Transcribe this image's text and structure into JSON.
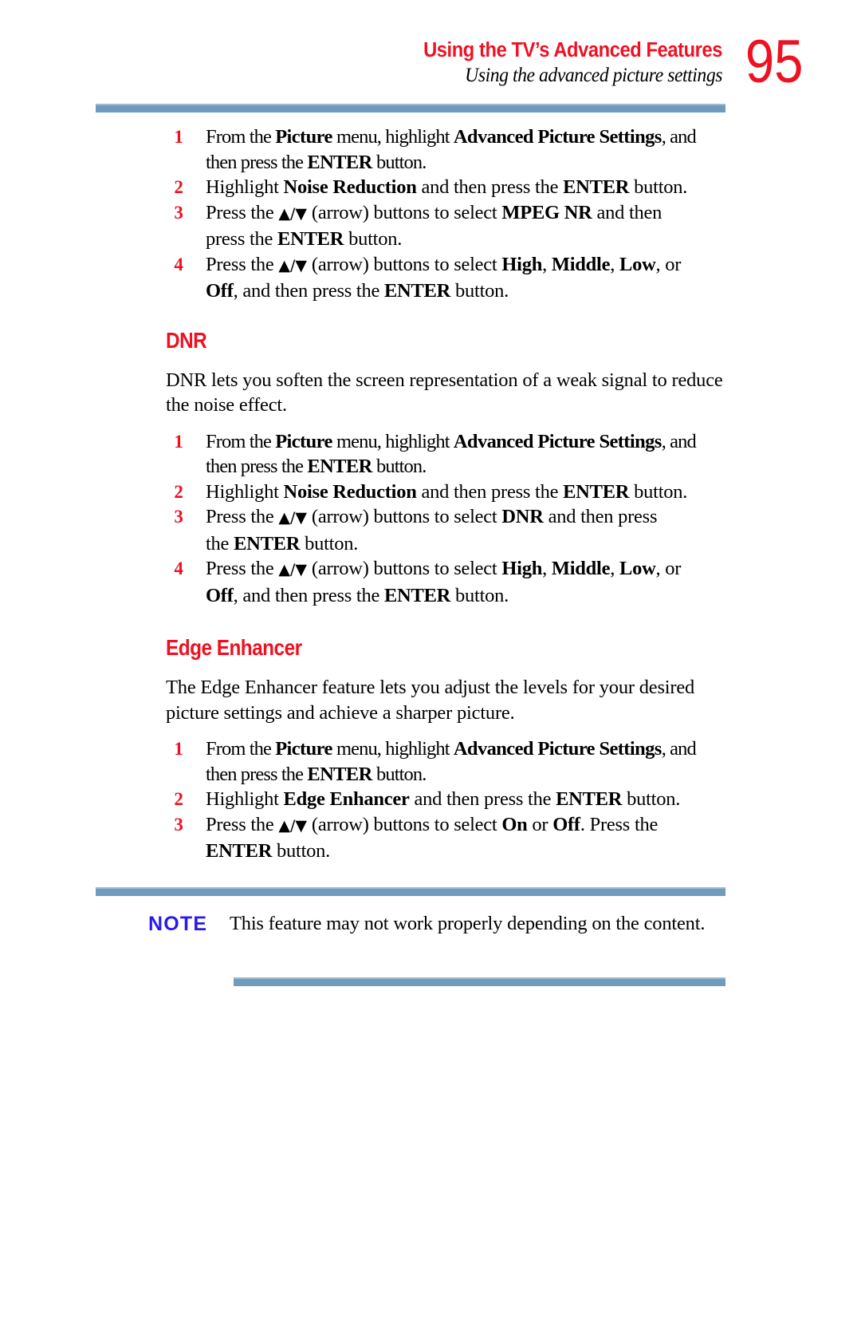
{
  "header": {
    "title": "Using the TV’s Advanced Features",
    "subtitle": "Using the advanced picture settings",
    "page_number": "95",
    "accent_color": "#ee1122",
    "rule_color": "#6f9bbd"
  },
  "mpeg_nr_steps": {
    "step1": {
      "num": "1",
      "line1_a": "From the ",
      "line1_b": "Picture",
      "line1_c": " menu, highlight ",
      "line1_d": "Advanced Picture Settings",
      "line1_e": ", and",
      "line2_a": "then press the ",
      "line2_b": "ENTER",
      "line2_c": " button."
    },
    "step2": {
      "num": "2",
      "a": " Highlight ",
      "b": "Noise Reduction",
      "c": " and then press the ",
      "d": "ENTER",
      "e": " button."
    },
    "step3": {
      "num": "3",
      "a": "Press the ",
      "arrows": "▲/▼",
      "b": " (arrow) buttons to select ",
      "c": "MPEG NR",
      "d": " and then",
      "line2_a": "press the ",
      "line2_b": "ENTER",
      "line2_c": " button."
    },
    "step4": {
      "num": "4",
      "a": "Press the ",
      "arrows": "▲/▼",
      "b": " (arrow) buttons to select ",
      "c": "High",
      "d": ", ",
      "e": "Middle",
      "f": ", ",
      "g": "Low",
      "h": ", or",
      "line2_a": "Off",
      "line2_b": ", and then press the ",
      "line2_c": "ENTER",
      "line2_d": " button."
    }
  },
  "dnr": {
    "heading": "DNR",
    "paragraph": "DNR lets you soften the screen representation of a weak signal to reduce the noise effect.",
    "step1": {
      "num": "1",
      "line1_a": "From the ",
      "line1_b": "Picture",
      "line1_c": " menu, highlight ",
      "line1_d": "Advanced Picture Settings",
      "line1_e": ", and",
      "line2_a": "then press the ",
      "line2_b": "ENTER",
      "line2_c": " button."
    },
    "step2": {
      "num": "2",
      "a": "Highlight ",
      "b": "Noise Reduction",
      "c": " and then press the ",
      "d": "ENTER",
      "e": " button."
    },
    "step3": {
      "num": "3",
      "a": "Press the ",
      "arrows": "▲/▼",
      "b": " (arrow)  buttons to select ",
      "c": "DNR",
      "d": " and then press",
      "line2_a": "the ",
      "line2_b": "ENTER",
      "line2_c": " button."
    },
    "step4": {
      "num": "4",
      "a": "Press the ",
      "arrows": "▲/▼",
      "b": " (arrow) buttons to select ",
      "c": "High",
      "d": ", ",
      "e": "Middle",
      "f": ", ",
      "g": "Low",
      "h": ", or",
      "line2_a": "Off",
      "line2_b": ", and then press the ",
      "line2_c": "ENTER",
      "line2_d": " button."
    }
  },
  "edge_enhancer": {
    "heading": "Edge Enhancer",
    "paragraph": "The Edge Enhancer feature lets you adjust the levels for your desired picture settings and achieve a sharper picture.",
    "step1": {
      "num": "1",
      "line1_a": "From the ",
      "line1_b": "Picture",
      "line1_c": " menu, highlight ",
      "line1_d": "Advanced Picture Settings",
      "line1_e": ", and",
      "line2_a": "then press the ",
      "line2_b": "ENTER",
      "line2_c": " button."
    },
    "step2": {
      "num": "2",
      "a": "Highlight ",
      "b": "Edge Enhancer",
      "c": " and then press the ",
      "d": "ENTER",
      "e": " button."
    },
    "step3": {
      "num": "3",
      "a": "Press the ",
      "arrows": "▲/▼",
      "b": " (arrow) buttons to select ",
      "c": "On",
      "d": " or ",
      "e": "Off",
      "f": ". Press the",
      "line2_a": "ENTER",
      "line2_b": " button."
    }
  },
  "note": {
    "label": "NOTE",
    "text": "This feature may not work properly depending on the content.",
    "label_color": "#2a19ee"
  }
}
